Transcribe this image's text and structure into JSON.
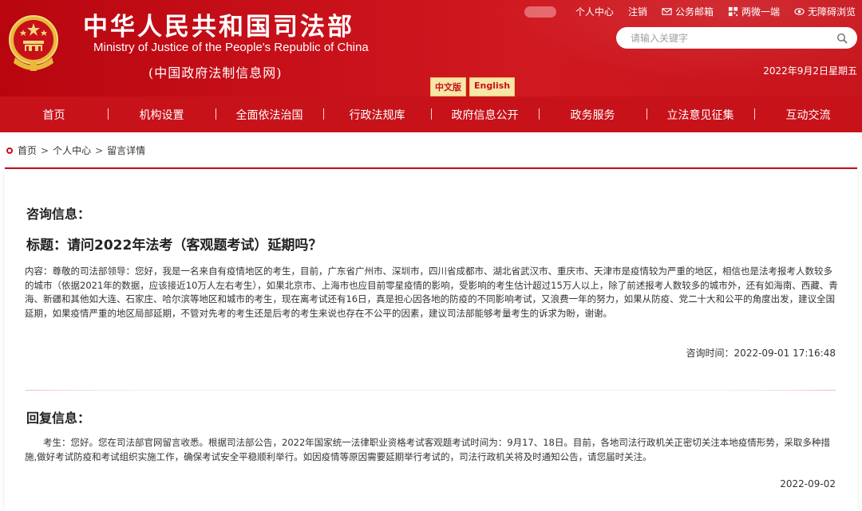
{
  "header": {
    "title": "中华人民共和国司法部",
    "subtitle": "Ministry of Justice of the People's Republic of China",
    "tagline": "(中国政府法制信息网)",
    "links": [
      {
        "label": "个人中心",
        "icon": "person-icon"
      },
      {
        "label": "注销",
        "icon": "logout-icon"
      },
      {
        "label": "公务邮箱",
        "icon": "mail-icon"
      },
      {
        "label": "两微一端",
        "icon": "qr-code-icon"
      },
      {
        "label": "无障碍浏览",
        "icon": "eye-icon"
      }
    ],
    "search_placeholder": "请输入关键字",
    "date": "2022年9月2日星期五",
    "lang_cn": "中文版",
    "lang_en": "English"
  },
  "nav": [
    "首页",
    "机构设置",
    "全面依法治国",
    "行政法规库",
    "政府信息公开",
    "政务服务",
    "立法意见征集",
    "互动交流"
  ],
  "breadcrumb": {
    "home": "首页",
    "level2": "个人中心",
    "current": "留言详情",
    "separator": ">"
  },
  "consult": {
    "heading": "咨询信息：",
    "title": "标题：请问2022年法考（客观题考试）延期吗？",
    "body": "内容：尊敬的司法部领导：您好，我是一名来自有疫情地区的考生，目前，广东省广州市、深圳市，四川省成都市、湖北省武汉市、重庆市、天津市是疫情较为严重的地区，相信也是法考报考人数较多的城市（依据2021年的数据，应该接近10万人左右考生），如果北京市、上海市也应目前零星疫情的影响，受影响的考生估计超过15万人以上，除了前述报考人数较多的城市外，还有如海南、西藏、青海、新疆和其他如大连、石家庄、哈尔滨等地区和城市的考生，现在离考试还有16日，真是担心因各地的防疫的不同影响考试，又浪费一年的努力，如果从防疫、党二十大和公平的角度出发，建议全国延期，如果疫情严重的地区局部延期，不管对先考的考生还是后考的考生来说也存在不公平的因素，建议司法部能够考量考生的诉求为盼，谢谢。",
    "time": "咨询时间：2022-09-01 17:16:48"
  },
  "reply": {
    "heading": "回复信息：",
    "body": "考生：您好。您在司法部官网留言收悉。根据司法部公告，2022年国家统一法律职业资格考试客观题考试时间为：9月17、18日。目前，各地司法行政机关正密切关注本地疫情形势，采取多种措施,做好考试防疫和考试组织实施工作，确保考试安全平稳顺利举行。如因疫情等原因需要延期举行考试的，司法行政机关将及时通知公告，请您届时关注。",
    "time": "2022-09-02"
  },
  "colors": {
    "brand_red": "#c8101a",
    "gold": "#f7e6a7"
  }
}
